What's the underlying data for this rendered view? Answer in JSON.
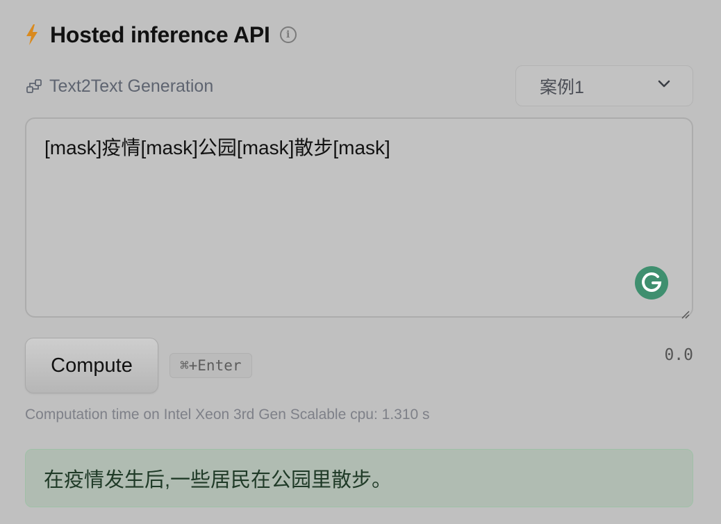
{
  "header": {
    "title": "Hosted inference API",
    "bolt_icon": "bolt-icon",
    "info_icon": "info-icon",
    "accent": "#d98a1f"
  },
  "task": {
    "label": "Text2Text Generation",
    "icon": "text2text-icon"
  },
  "examples": {
    "selected": "案例1"
  },
  "input": {
    "value": "[mask]疫情[mask]公园[mask]散步[mask]"
  },
  "actions": {
    "compute_label": "Compute",
    "shortcut": "⌘+Enter",
    "timer": "0.0"
  },
  "computation": {
    "text": "Computation time on Intel Xeon 3rd Gen Scalable cpu: 1.310 s"
  },
  "output": {
    "text": "在疫情发生后,一些居民在公园里散步。"
  },
  "colors": {
    "background": "#c0c0c0",
    "grammarly": "#3f8f6f",
    "output_bg": "#b0bcb2"
  }
}
